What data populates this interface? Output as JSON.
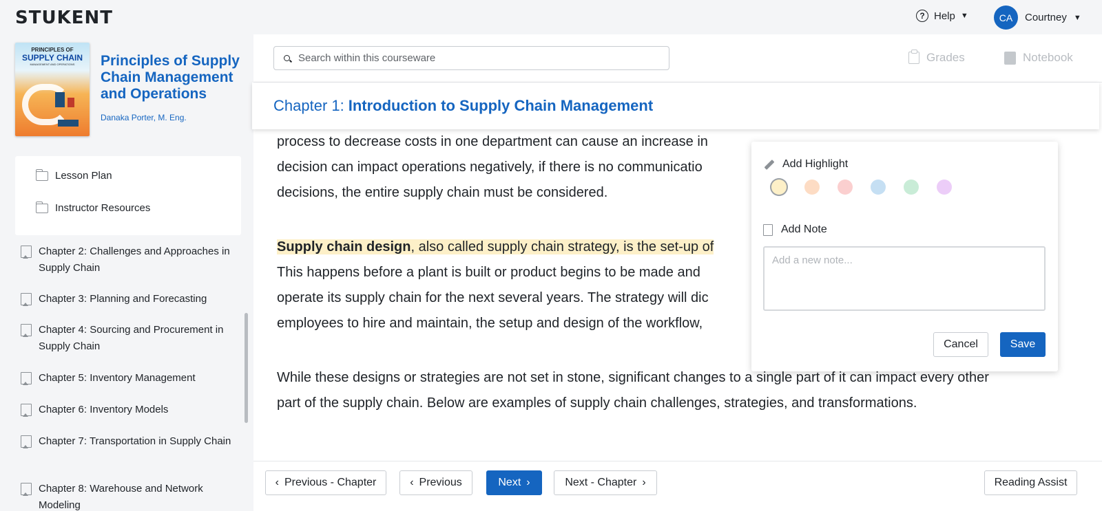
{
  "app": {
    "logo": "STUKENT"
  },
  "topbar": {
    "help_label": "Help",
    "user_initials": "CA",
    "user_name": "Courtney"
  },
  "book": {
    "cover_line1": "PRINCIPLES OF",
    "cover_line2": "SUPPLY CHAIN",
    "cover_line3": "MANAGEMENT AND OPERATIONS",
    "title": "Principles of Supply Chain Management and Operations",
    "author": "Danaka Porter, M. Eng."
  },
  "sidebar": {
    "sub_items": [
      {
        "label": "Lesson Plan"
      },
      {
        "label": "Instructor Resources"
      }
    ],
    "chapters": [
      {
        "label": "Chapter 2: Challenges and Approaches in Supply Chain"
      },
      {
        "label": "Chapter 3: Planning and Forecasting"
      },
      {
        "label": "Chapter 4: Sourcing and Procurement in Supply Chain"
      },
      {
        "label": "Chapter 5: Inventory Management"
      },
      {
        "label": "Chapter 6: Inventory Models"
      },
      {
        "label": "Chapter 7: Transportation in Supply Chain"
      },
      {
        "label": "Chapter 8: Warehouse and Network Modeling"
      }
    ]
  },
  "search": {
    "placeholder": "Search within this courseware"
  },
  "tools": {
    "grades": "Grades",
    "notebook": "Notebook"
  },
  "chapter": {
    "prefix": "Chapter 1:",
    "title": "Introduction to Supply Chain Management"
  },
  "content": {
    "p1_lines": [
      "process to decrease costs in one department can cause an increase in",
      "decision can impact operations negatively, if there is no communicatio",
      "decisions, the entire supply chain must be considered."
    ],
    "p2_bold": "Supply chain design",
    "p2_rest": ", also called supply chain strategy, is the set-up of",
    "p2_lines": [
      "This happens before a plant is built or product begins to be made and",
      "operate its supply chain for the next several years. The strategy will dic",
      "employees to hire and maintain, the setup and design of the workflow,"
    ],
    "p3_lines": [
      "While these designs or strategies are not set in stone, significant changes to a single part of it can impact every other",
      "part of the supply chain. Below are examples of supply chain challenges, strategies, and transformations."
    ]
  },
  "popup": {
    "highlight_label": "Add Highlight",
    "highlight_colors": [
      "#fdf0c8",
      "#fddcc4",
      "#fbcfcf",
      "#c5dff3",
      "#c9ecd7",
      "#eccdf8"
    ],
    "selected_color": "#fdf0c8",
    "note_label": "Add Note",
    "note_placeholder": "Add a new note...",
    "cancel": "Cancel",
    "save": "Save"
  },
  "footer": {
    "prev_chapter": "Previous - Chapter",
    "previous": "Previous",
    "next": "Next",
    "next_chapter": "Next - Chapter",
    "reading_assist": "Reading Assist"
  },
  "colors": {
    "accent": "#1565c0",
    "highlight": "#fdf0c8"
  }
}
